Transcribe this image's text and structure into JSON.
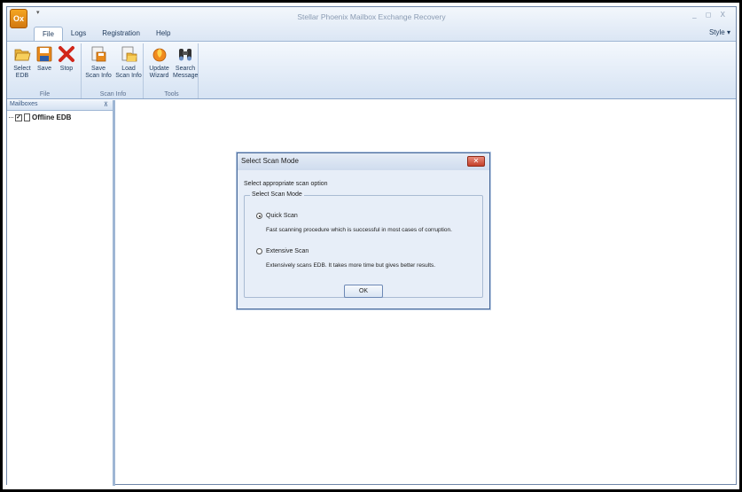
{
  "window": {
    "title": "Stellar Phoenix Mailbox Exchange Recovery",
    "controls": "_ ◻ X"
  },
  "tabs": [
    "File",
    "Logs",
    "Registration",
    "Help"
  ],
  "style_menu": "Style ▾",
  "ribbon": {
    "groups": {
      "file": {
        "label": "File",
        "buttons": {
          "select_edb": "Select\nEDB",
          "save": "Save",
          "stop": "Stop"
        }
      },
      "scan_info": {
        "label": "Scan Info",
        "buttons": {
          "save_scan_info": "Save\nScan Info",
          "load_scan_info": "Load\nScan Info"
        }
      },
      "tools": {
        "label": "Tools",
        "buttons": {
          "update_wizard": "Update\nWizard",
          "search_message": "Search\nMessage"
        }
      }
    }
  },
  "sidebar": {
    "header": "Mailboxes",
    "pin": "⊼",
    "tree_item": "Offline EDB"
  },
  "dialog": {
    "title": "Select Scan Mode",
    "close": "✕",
    "prompt": "Select appropriate scan option",
    "group_label": "Select Scan Mode",
    "options": [
      {
        "label": "Quick Scan",
        "description": "Fast scanning procedure which is successful in most cases of corruption.",
        "selected": true
      },
      {
        "label": "Extensive Scan",
        "description": "Extensively scans EDB. It takes more time but gives better results.",
        "selected": false
      }
    ],
    "ok_label": "OK"
  }
}
